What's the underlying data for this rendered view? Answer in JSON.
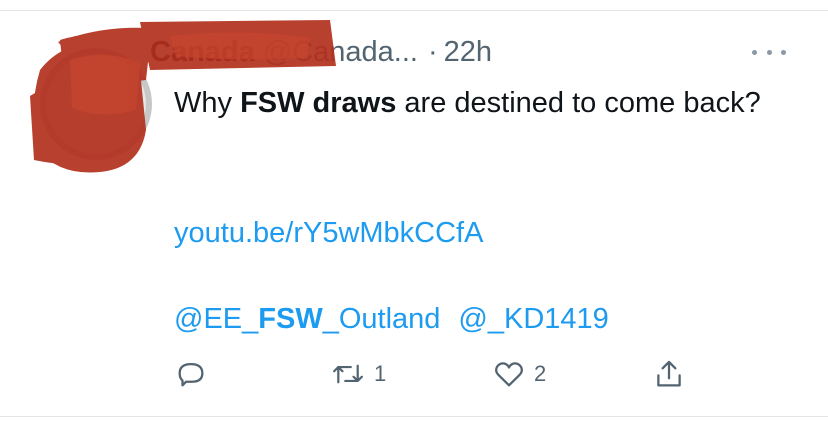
{
  "tweet": {
    "author_name": "Canada",
    "author_handle": "@Canada...",
    "separator": "·",
    "time": "22h",
    "text_prefix": "Why ",
    "text_bold": "FSW draws",
    "text_suffix": " are destined to come back?",
    "link_url": "youtu.be/rY5wMbkCCfA",
    "mention_1_pre": "@EE_",
    "mention_1_bold": "FSW",
    "mention_1_post": "_Outland",
    "mention_2": "@_KD1419"
  },
  "actions": {
    "reply_icon": "reply-icon",
    "retweet_icon": "retweet-icon",
    "retweet_count": "1",
    "like_icon": "heart-icon",
    "like_count": "2",
    "share_icon": "share-icon"
  },
  "colors": {
    "link": "#1d9bf0",
    "muted": "#536471",
    "text": "#0f1419",
    "redaction": "#b3301e"
  }
}
